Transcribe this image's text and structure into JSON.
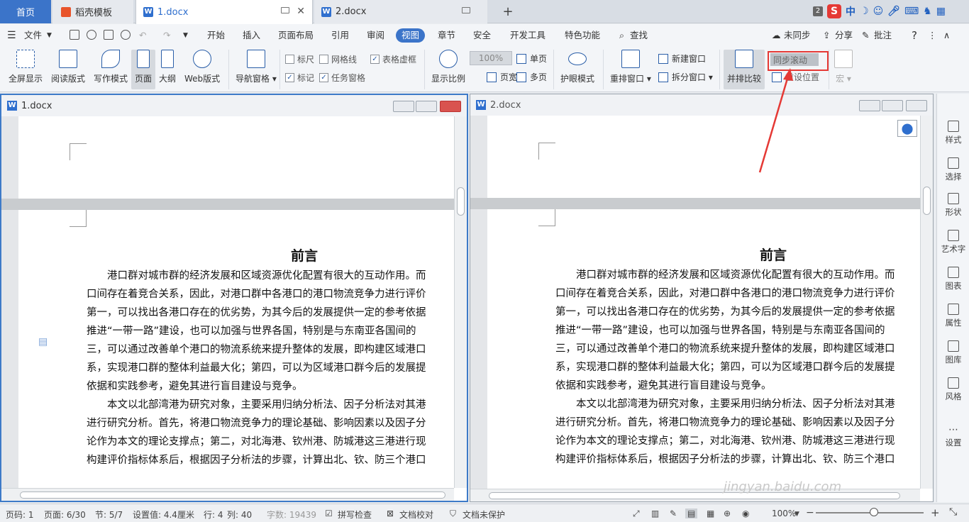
{
  "tabbar": {
    "home": "首页",
    "template": "稻壳模板",
    "doc1": "1.docx",
    "doc2": "2.docx",
    "add": "+",
    "tray_badge": "2",
    "tray_s": "S",
    "tray_zh": "中"
  },
  "menubar": {
    "file": "文件",
    "items": [
      "开始",
      "插入",
      "页面布局",
      "引用",
      "审阅",
      "视图",
      "章节",
      "安全",
      "开发工具",
      "特色功能"
    ],
    "search": "查找",
    "unsynced": "未同步",
    "share": "分享",
    "comment": "批注",
    "help": "?"
  },
  "ribbon": {
    "fullscreen": "全屏显示",
    "reading": "阅读版式",
    "writing": "写作模式",
    "page": "页面",
    "outline": "大纲",
    "web": "Web版式",
    "nav_pane": "导航窗格",
    "ruler": "标尺",
    "gridlines": "网格线",
    "table_gridlines": "表格虚框",
    "marks": "标记",
    "task_pane": "任务窗格",
    "zoom_ratio": "显示比例",
    "zoom_100": "100%",
    "single_page": "单页",
    "page_width": "页宽",
    "multi_page": "多页",
    "eye_mode": "护眼模式",
    "rearrange": "重排窗口",
    "new_window": "新建窗口",
    "split_window": "拆分窗口",
    "side_by_side": "并排比较",
    "sync_scroll": "同步滚动",
    "reset_position": "重设位置",
    "macro": "宏"
  },
  "checks": {
    "ruler": false,
    "gridlines": false,
    "table_gridlines": true,
    "marks": true,
    "task_pane": true
  },
  "doc": {
    "title": "前言",
    "lines": [
      "　　港口群对城市群的经济发展和区域资源优化配置有很大的互动作用。而",
      "口间存在着竞合关系，因此，对港口群中各港口的港口物流竞争力进行评价",
      "第一，可以找出各港口存在的优劣势，为其今后的发展提供一定的参考依据",
      "推进“一带一路”建设，也可以加强与世界各国，特别是与东南亚各国间的",
      "三，可以通过改善单个港口的物流系统来提升整体的发展，即构建区域港口",
      "系，实现港口群的整体利益最大化；第四，可以为区域港口群今后的发展提",
      "依据和实践参考，避免其进行盲目建设与竞争。",
      "　　本文以北部湾港为研究对象，主要采用归纳分析法、因子分析法对其港",
      "进行研究分析。首先，将港口物流竞争力的理论基础、影响因素以及因子分",
      "论作为本文的理论支撑点；第二，对北海港、钦州港、防城港这三港进行现",
      "构建评价指标体系后，根据因子分析法的步骤，计算出北、钦、防三个港口"
    ]
  },
  "sidebar": [
    "样式",
    "选择",
    "形状",
    "艺术字",
    "图表",
    "属性",
    "图库",
    "风格",
    "设置"
  ],
  "watermark": "jingyan.baidu.com",
  "status": {
    "page_num": "页码: 1",
    "pages": "页面: 6/30",
    "section": "节: 5/7",
    "setting": "设置值: 4.4厘米",
    "row": "行: 4",
    "col": "列: 40",
    "wordcount": "字数: 19439",
    "spell": "拼写检查",
    "proof": "文档校对",
    "protect": "文档未保护",
    "zoom": "100%",
    "zoom_minus": "−",
    "zoom_plus": "+"
  },
  "colors": {
    "accent": "#3b74c9",
    "highlight": "#e53935"
  }
}
